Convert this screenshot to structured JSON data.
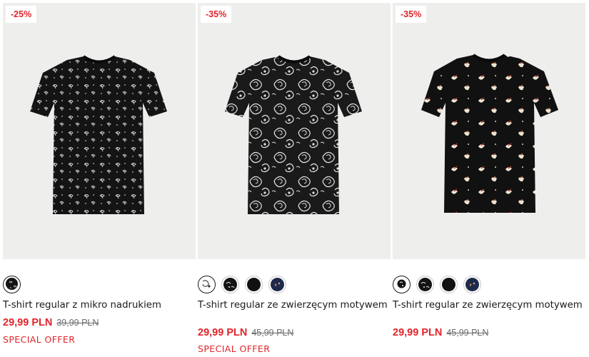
{
  "products": [
    {
      "discount": "-25%",
      "title": "T-shirt regular z mikro nadrukiem",
      "price": "29,99 PLN",
      "old_price": "39,99 PLN",
      "promo": "SPECIAL OFFER",
      "pattern": "micro-floral",
      "swatches": [
        {
          "name": "black-micro-print",
          "color": "#111111",
          "selected": true
        }
      ]
    },
    {
      "discount": "-35%",
      "title": "T-shirt regular ze zwierzęcym motywem",
      "price": "29,99 PLN",
      "old_price": "45,99 PLN",
      "promo": "SPECIAL OFFER",
      "pattern": "paisley",
      "swatches": [
        {
          "name": "black-paisley",
          "color": "#111111",
          "selected": true
        },
        {
          "name": "black-white-print",
          "color": "#111111",
          "selected": false
        },
        {
          "name": "black-plain",
          "color": "#111111",
          "selected": false
        },
        {
          "name": "navy-print",
          "color": "#1f2a4a",
          "selected": false
        }
      ]
    },
    {
      "discount": "-35%",
      "title": "T-shirt regular ze zwierzęcym motywem",
      "price": "29,99 PLN",
      "old_price": "45,99 PLN",
      "promo": "",
      "pattern": "birds",
      "swatches": [
        {
          "name": "black-birds",
          "color": "#111111",
          "selected": true
        },
        {
          "name": "black-white-print",
          "color": "#111111",
          "selected": false
        },
        {
          "name": "black-plain",
          "color": "#111111",
          "selected": false
        },
        {
          "name": "navy-print",
          "color": "#1f2a4a",
          "selected": false
        }
      ]
    }
  ],
  "colors": {
    "sale_red": "#e1242b",
    "image_bg": "#eeeeec",
    "text": "#1a1a1a",
    "muted": "#6b6b6b"
  }
}
